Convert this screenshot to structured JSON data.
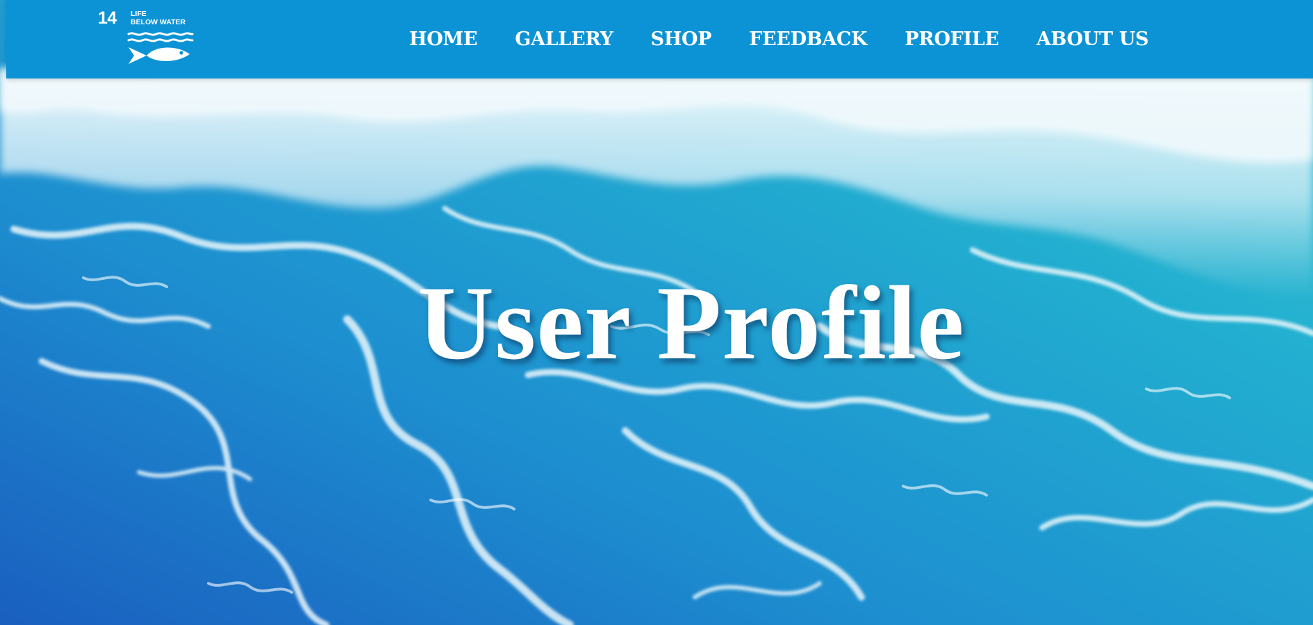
{
  "logo": {
    "number": "14",
    "line1": "LIFE",
    "line2": "BELOW WATER",
    "icon": "fish-waves-icon"
  },
  "nav": {
    "items": [
      {
        "label": "HOME"
      },
      {
        "label": "GALLERY"
      },
      {
        "label": "SHOP"
      },
      {
        "label": "FEEDBACK"
      },
      {
        "label": "PROFILE"
      },
      {
        "label": "ABOUT US"
      }
    ]
  },
  "hero": {
    "title": "User Profile",
    "background": "ocean-waves-foam-image"
  },
  "colors": {
    "navbar": "#0b93d5",
    "nav_text": "#ffffff",
    "water_deep": "#1b6fc4",
    "water_light": "#2cc0c8",
    "foam": "#eaf6fb"
  }
}
